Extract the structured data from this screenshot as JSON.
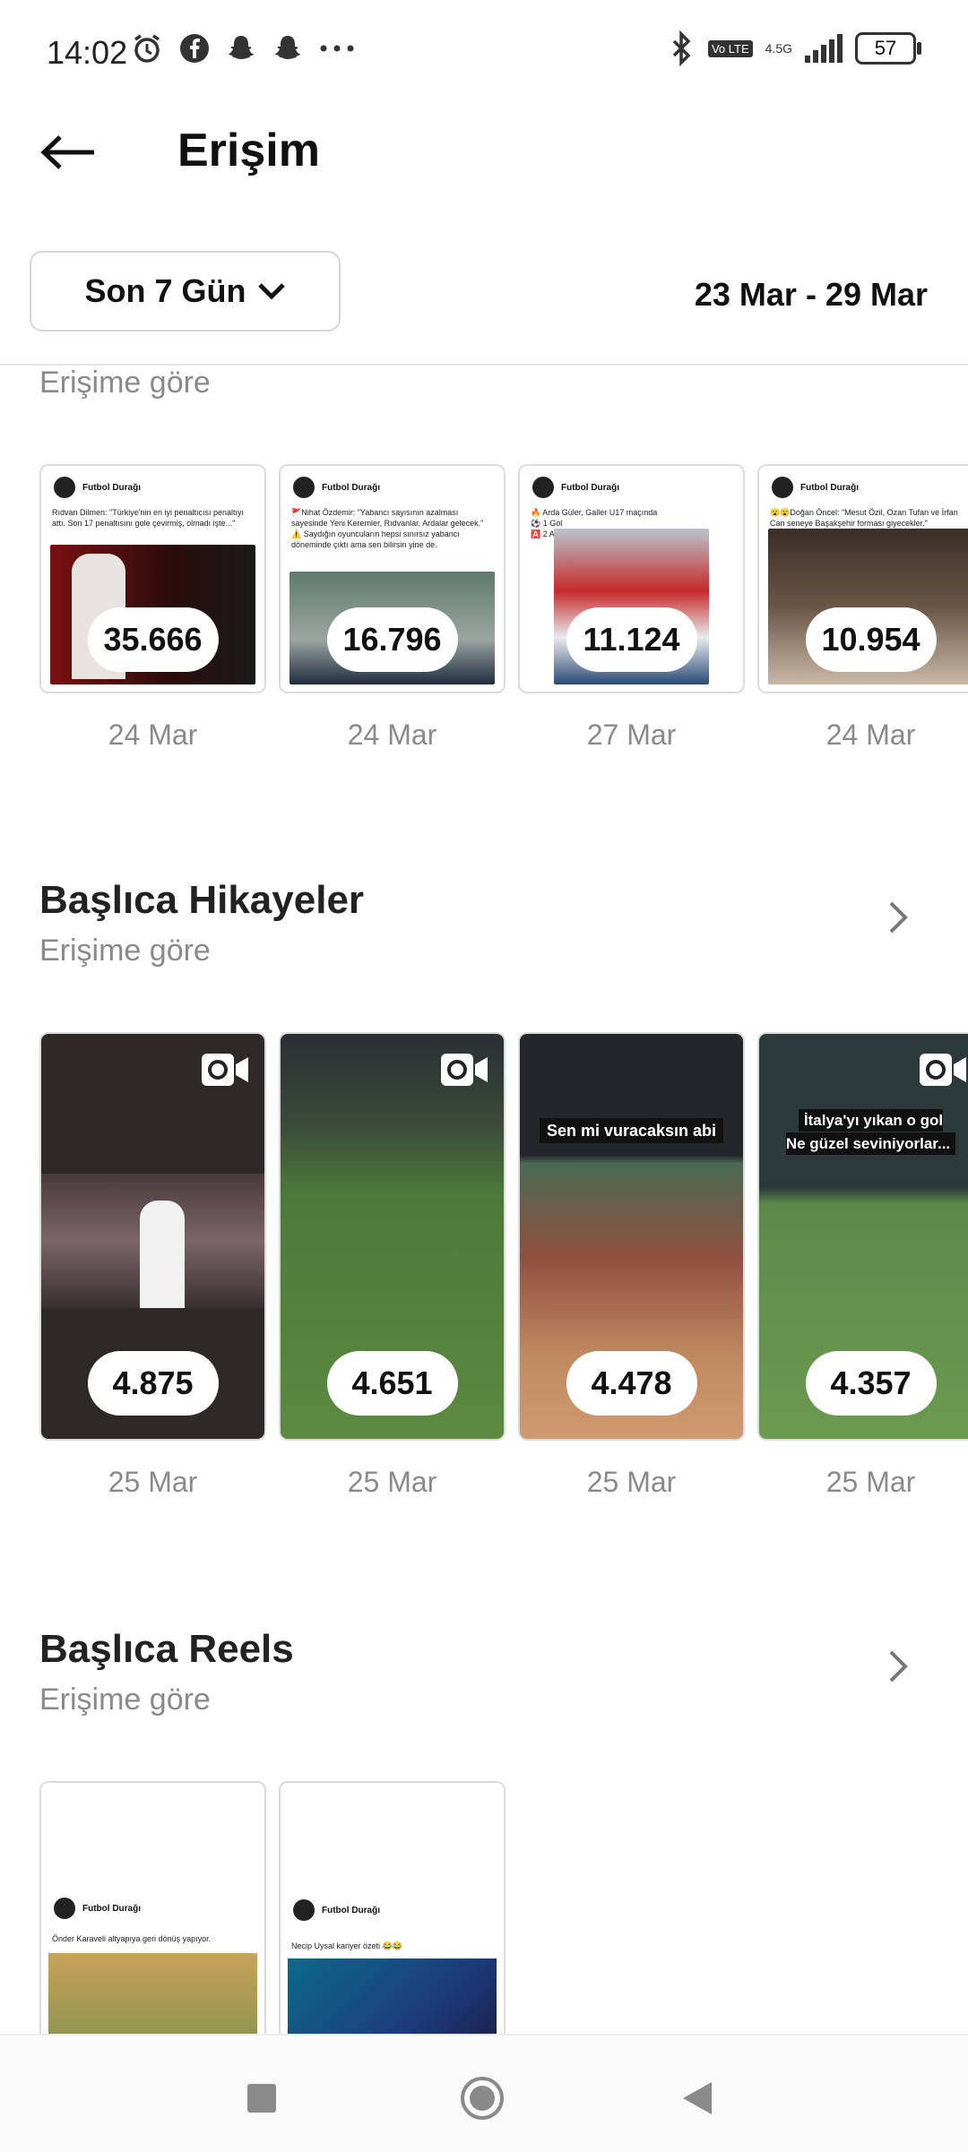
{
  "status": {
    "time": "14:02",
    "net_label": "4.5G",
    "lte_label": "Vo LTE",
    "battery": "57"
  },
  "header": {
    "title": "Erişim"
  },
  "range": {
    "label": "Son 7 Gün",
    "dates": "23 Mar - 29 Mar"
  },
  "posts_section": {
    "subtitle": "Erişime göre",
    "items": [
      {
        "value": "35.666",
        "date": "24 Mar",
        "account": "Futbol Durağı",
        "caption": "Rıdvan Dilmen: \"Türkiye'nin en iyi penaltıcısı penaltıyı attı. Son 17 penaltısını gole çevirmiş, olmadı işte...\""
      },
      {
        "value": "16.796",
        "date": "24 Mar",
        "account": "Futbol Durağı",
        "caption": "🚩Nihat Özdemir: \"Yabancı sayısının azalması sayesinde Yeni Keremler, Rıdvanlar, Ardalar gelecek.\"\n⚠️ Saydığın oyuncuların hepsi sınırsız yabancı döneminde çıktı ama sen bilirsin yine de."
      },
      {
        "value": "11.124",
        "date": "27 Mar",
        "account": "Futbol Durağı",
        "caption": "🔥 Arda Güler, Galler U17 maçında\n⚽ 1 Gol\n🅰️ 2 Asist"
      },
      {
        "value": "10.954",
        "date": "24 Mar",
        "account": "Futbol Durağı",
        "caption": "😮😮Doğan Öncel: \"Mesut Özil, Ozan Tufan ve İrfan Can seneye Başakşehir forması giyecekler.\""
      }
    ]
  },
  "stories_section": {
    "title": "Başlıca Hikayeler",
    "subtitle": "Erişime göre",
    "items": [
      {
        "value": "4.875",
        "date": "25 Mar",
        "overlay": ""
      },
      {
        "value": "4.651",
        "date": "25 Mar",
        "overlay": ""
      },
      {
        "value": "4.478",
        "date": "25 Mar",
        "overlay": "Sen mi vuracaksın abi"
      },
      {
        "value": "4.357",
        "date": "25 Mar",
        "overlay": "İtalya'yı yıkan o gol\nNe güzel seviniyorlar..."
      }
    ]
  },
  "reels_section": {
    "title": "Başlıca Reels",
    "subtitle": "Erişime göre",
    "items": [
      {
        "account": "Futbol Durağı",
        "caption": "Önder Karaveli altyapıya geri dönüş yapıyor."
      },
      {
        "account": "Futbol Durağı",
        "caption": "Necip Uysal kariyer özeti 😂😂"
      }
    ]
  },
  "icons": [
    "alarm-icon",
    "facebook-icon",
    "snapchat-icon",
    "snapchat-icon",
    "more-dots-icon",
    "bluetooth-icon",
    "signal-icon",
    "battery-icon",
    "back-arrow-icon",
    "chevron-down-icon",
    "chevron-right-icon",
    "video-camera-icon",
    "recents-nav-icon",
    "home-nav-icon",
    "back-nav-icon"
  ]
}
